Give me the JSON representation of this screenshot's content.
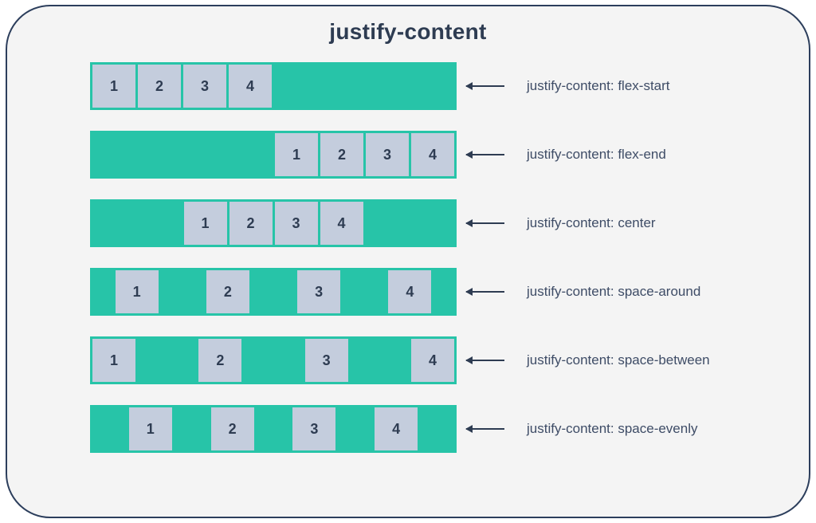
{
  "title": "justify-content",
  "items": [
    "1",
    "2",
    "3",
    "4"
  ],
  "rows": [
    {
      "class": "jstart",
      "label": "justify-content: flex-start"
    },
    {
      "class": "jend",
      "label": "justify-content: flex-end"
    },
    {
      "class": "jcenter",
      "label": "justify-content: center"
    },
    {
      "class": "jsaround",
      "label": "justify-content: space-around"
    },
    {
      "class": "jsbetween",
      "label": "justify-content: space-between"
    },
    {
      "class": "jsevenly",
      "label": "justify-content: space-evenly"
    }
  ]
}
